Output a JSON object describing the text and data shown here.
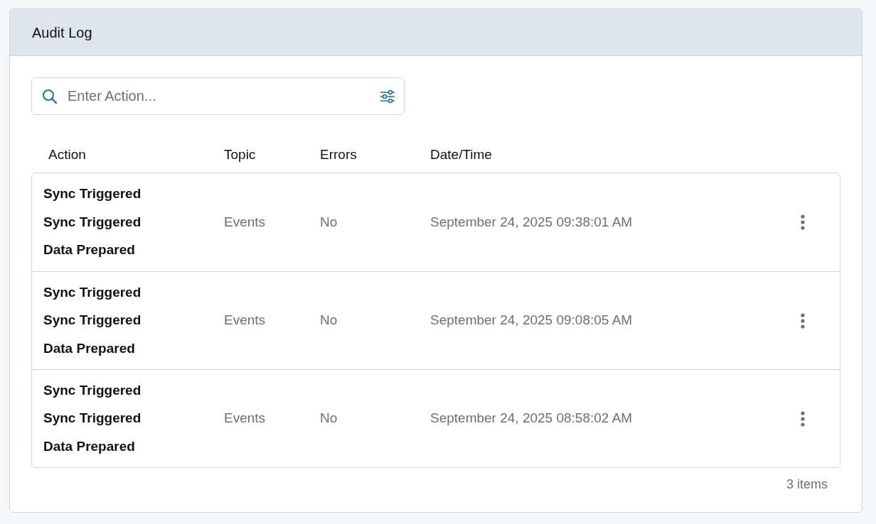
{
  "panel": {
    "title": "Audit Log"
  },
  "search": {
    "placeholder": "Enter Action..."
  },
  "table": {
    "columns": [
      "Action",
      "Topic",
      "Errors",
      "Date/Time"
    ],
    "rows": [
      {
        "actions": [
          "Sync Triggered",
          "Sync Triggered",
          "Data Prepared"
        ],
        "topic": "Events",
        "errors": "No",
        "datetime": "September 24, 2025 09:38:01 AM"
      },
      {
        "actions": [
          "Sync Triggered",
          "Sync Triggered",
          "Data Prepared"
        ],
        "topic": "Events",
        "errors": "No",
        "datetime": "September 24, 2025 09:08:05 AM"
      },
      {
        "actions": [
          "Sync Triggered",
          "Sync Triggered",
          "Data Prepared"
        ],
        "topic": "Events",
        "errors": "No",
        "datetime": "September 24, 2025 08:58:02 AM"
      }
    ]
  },
  "footer": {
    "count": "3 items"
  }
}
